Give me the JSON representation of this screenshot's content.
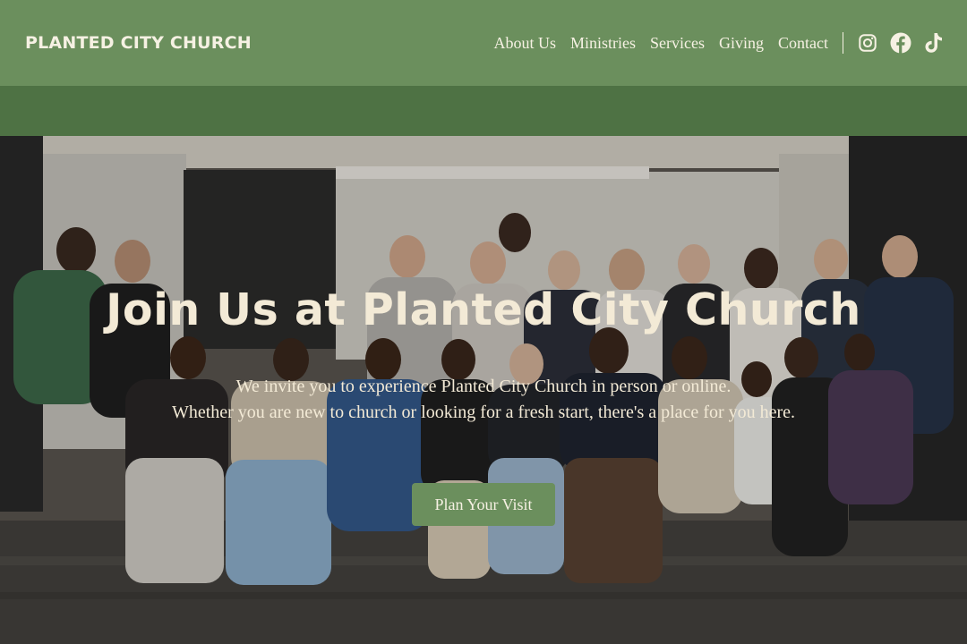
{
  "header": {
    "brand": "PLANTED CITY CHURCH",
    "nav": [
      {
        "label": "About Us"
      },
      {
        "label": "Ministries"
      },
      {
        "label": "Services"
      },
      {
        "label": "Giving"
      },
      {
        "label": "Contact"
      }
    ],
    "social": [
      "instagram-icon",
      "facebook-icon",
      "tiktok-icon"
    ]
  },
  "hero": {
    "title": "Join Us at Planted City Church",
    "subtitle_line1": "We invite you to experience Planted City Church in person or online.",
    "subtitle_line2": "Whether you are new to church or looking for a fresh start, there's a place for you here.",
    "cta_label": "Plan Your Visit"
  },
  "colors": {
    "header_bg": "#6b8f5d",
    "band_bg": "#4e7244",
    "text_cream": "#f3ead6",
    "button_bg": "#6b8f5d"
  }
}
